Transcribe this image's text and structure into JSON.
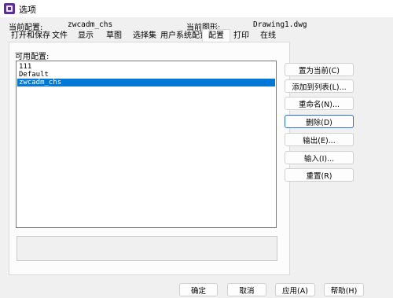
{
  "window": {
    "title": "选项"
  },
  "header": {
    "current_profile_label": "当前配置:",
    "current_profile_value": "zwcadm_chs",
    "current_drawing_label": "当前图形:",
    "current_drawing_value": "Drawing1.dwg"
  },
  "tabs": [
    {
      "label": "打开和保存"
    },
    {
      "label": "文件"
    },
    {
      "label": "显示"
    },
    {
      "label": "草图"
    },
    {
      "label": "选择集"
    },
    {
      "label": "用户系统配置"
    },
    {
      "label": "配置",
      "active": true
    },
    {
      "label": "打印"
    },
    {
      "label": "在线"
    }
  ],
  "profiles": {
    "label": "可用配置:",
    "items": [
      {
        "name": "111"
      },
      {
        "name": "Default"
      },
      {
        "name": "zwcadm_chs",
        "selected": true
      }
    ],
    "description": ""
  },
  "actions": {
    "set_current": "置为当前(C)",
    "add_to_list": "添加到列表(L)...",
    "rename": "重命名(N)...",
    "delete": "删除(D)",
    "export": "输出(E)...",
    "import": "输入(I)...",
    "reset": "重置(R)"
  },
  "footer": {
    "ok": "确定",
    "cancel": "取消",
    "apply": "应用(A)",
    "help": "帮助(H)"
  },
  "colors": {
    "selection": "#0078d7",
    "focus_border": "#2a6fd6",
    "app_icon": "#5a2da0"
  }
}
